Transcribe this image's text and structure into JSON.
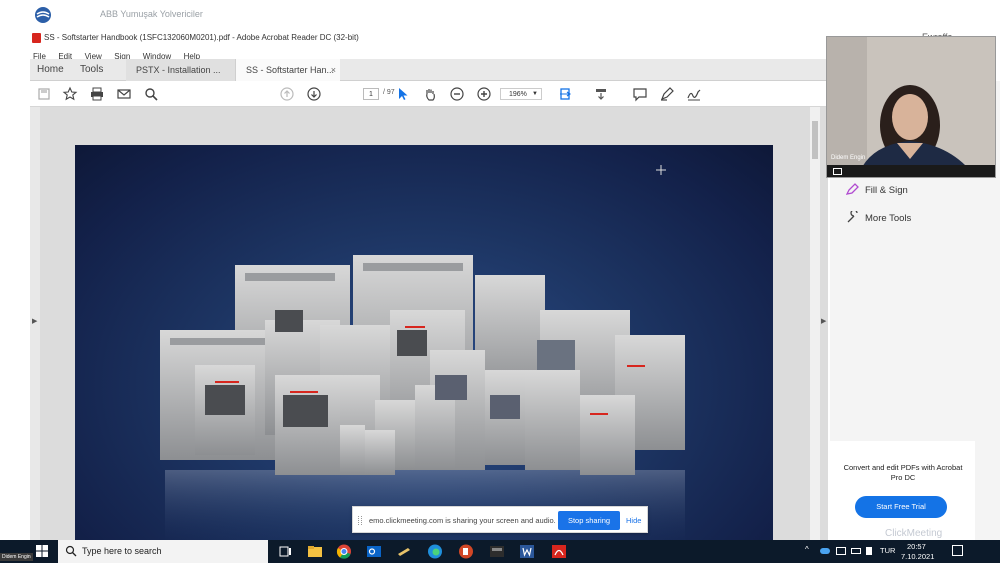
{
  "meeting": {
    "title": "ABB Yumuşak Yolvericiler",
    "right_label": "Ewraffe"
  },
  "acrobat": {
    "window_title": "SS - Softstarter Handbook (1SFC132060M0201).pdf - Adobe Acrobat Reader DC (32-bit)",
    "menu": [
      "File",
      "Edit",
      "View",
      "Sign",
      "Window",
      "Help"
    ],
    "nav_tabs": [
      "Home",
      "Tools"
    ],
    "doc_tabs": [
      "PSTX - Installation ...",
      "SS - Softstarter Han..."
    ],
    "close_glyph": "×",
    "page_current": "1",
    "page_total": "/ 97",
    "zoom": "196%"
  },
  "right_panel": {
    "fill_sign": "Fill & Sign",
    "more_tools": "More Tools",
    "promo_text": "Convert and edit PDFs with Acrobat Pro DC",
    "trial_button": "Start Free Trial"
  },
  "webcam": {
    "name": "Didem Engin"
  },
  "share_banner": {
    "message": "emo.clickmeeting.com is sharing your screen and audio.",
    "stop_button": "Stop sharing",
    "hide": "Hide"
  },
  "taskbar": {
    "search_placeholder": "Type here to search",
    "language": "TUR",
    "time": "20:57",
    "date": "7.10.2021",
    "presenter": "Didem Engin"
  },
  "watermark": "ClickMeeting",
  "colors": {
    "acrobat_red": "#d7261e",
    "accent_blue": "#1473e6",
    "taskbar": "#0c1a2a"
  }
}
